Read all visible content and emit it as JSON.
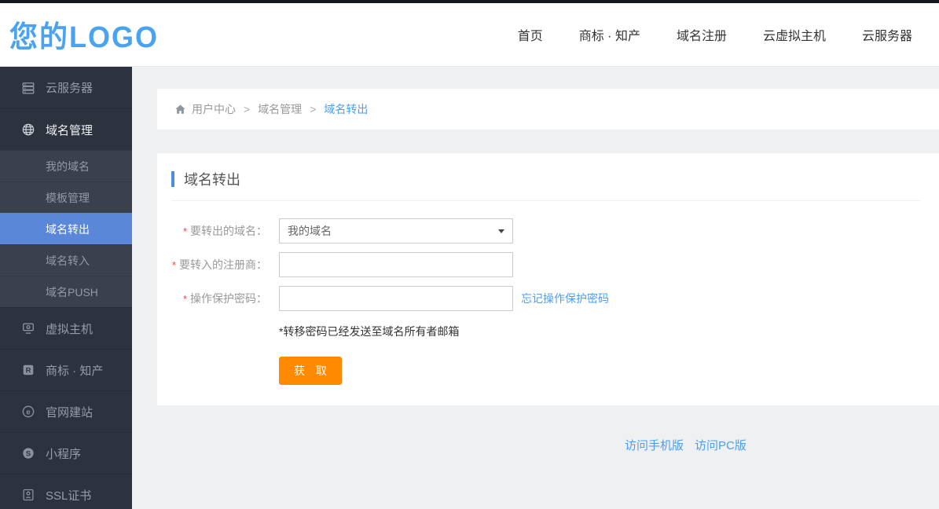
{
  "header": {
    "logo": "您的LOGO",
    "nav": [
      "首页",
      "商标 · 知产",
      "域名注册",
      "云虚拟主机",
      "云服务器"
    ]
  },
  "sidebar": {
    "items": [
      {
        "label": "云服务器",
        "icon": "server-icon",
        "active": false
      },
      {
        "label": "域名管理",
        "icon": "globe-icon",
        "active": true,
        "children": [
          {
            "label": "我的域名",
            "active": false
          },
          {
            "label": "模板管理",
            "active": false
          },
          {
            "label": "域名转出",
            "active": true
          },
          {
            "label": "域名转入",
            "active": false
          },
          {
            "label": "域名PUSH",
            "active": false
          }
        ]
      },
      {
        "label": "虚拟主机",
        "icon": "host-icon",
        "active": false
      },
      {
        "label": "商标 · 知产",
        "icon": "trademark-icon",
        "active": false
      },
      {
        "label": "官网建站",
        "icon": "website-icon",
        "active": false
      },
      {
        "label": "小程序",
        "icon": "miniprogram-icon",
        "active": false
      },
      {
        "label": "SSL证书",
        "icon": "certificate-icon",
        "active": false
      }
    ]
  },
  "breadcrumb": {
    "home_icon": "home-icon",
    "separator": ">",
    "items": [
      "用户中心",
      "域名管理",
      "域名转出"
    ]
  },
  "panel": {
    "title": "域名转出",
    "form": {
      "fields": [
        {
          "label": "要转出的域名：",
          "required": true,
          "type": "select",
          "value": "我的域名"
        },
        {
          "label": "要转入的注册商：",
          "required": true,
          "type": "input",
          "value": "",
          "placeholder": ""
        },
        {
          "label": "操作保护密码：",
          "required": true,
          "type": "input",
          "value": "",
          "placeholder": "",
          "link": "忘记操作保护密码"
        }
      ],
      "note": "*转移密码已经发送至域名所有者邮箱",
      "submit_label": "获 取"
    }
  },
  "footer": {
    "links": [
      "访问手机版",
      "访问PC版"
    ]
  },
  "colors": {
    "logo_blue": "#4aa3ee",
    "accent_blue": "#4a9ff0",
    "active_sidebar_bg": "#5a87d7",
    "button_orange": "#ff8a00",
    "sidebar_bg": "#2d333e",
    "submenu_bg": "#3a414c",
    "page_bg": "#eef0f2"
  }
}
